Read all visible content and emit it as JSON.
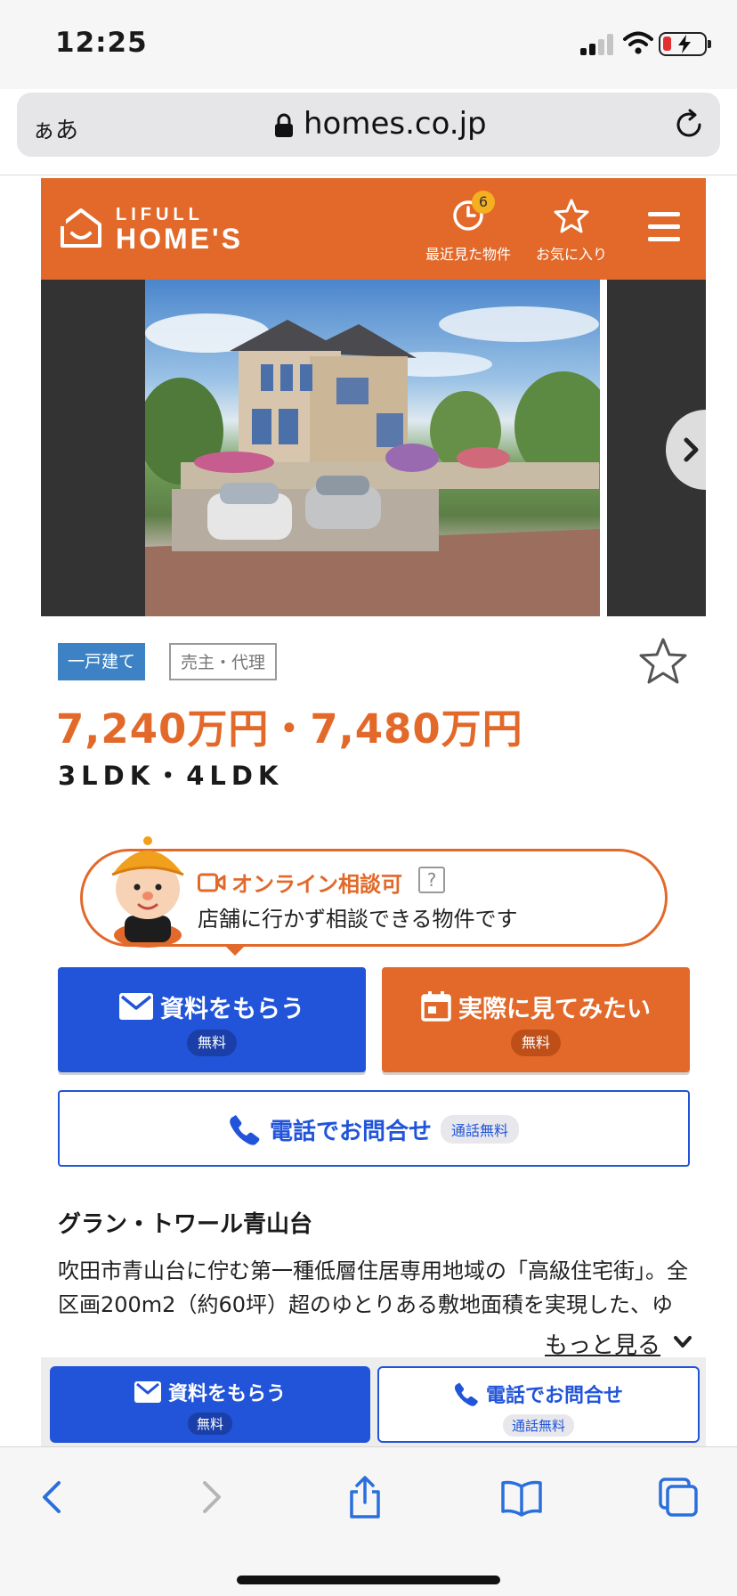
{
  "status_bar": {
    "time": "12:25"
  },
  "browser": {
    "text_size_label": "ぁあ",
    "url": "homes.co.jp"
  },
  "site_header": {
    "logo_top": "LIFULL",
    "logo_main": "HOME'S",
    "recent_label": "最近見た物件",
    "recent_count": "6",
    "favorites_label": "お気に入り"
  },
  "property": {
    "type_tag": "一戸建て",
    "deal_tag": "売主・代理",
    "price": "7,240万円・7,480万円",
    "layout": "3LDK・4LDK",
    "name": "グラン・トワール青山台",
    "description": "吹田市青山台に佇む第一種低層住居専用地域の「高級住宅街」。全区画200m2（約60坪）超のゆとりある敷地面積を実現した、ゆとりある住まい。",
    "more_label": "もっと見る"
  },
  "online": {
    "title": "オンライン相談可",
    "help": "?",
    "description": "店舗に行かず相談できる物件です"
  },
  "cta": {
    "request_docs": "資料をもらう",
    "request_docs_free": "無料",
    "visit": "実際に見てみたい",
    "visit_free": "無料",
    "phone": "電話でお問合せ",
    "phone_free": "通話無料"
  },
  "sticky_bar": {
    "request_docs": "資料をもらう",
    "request_docs_free": "無料",
    "phone": "電話でお問合せ",
    "phone_free": "通話無料"
  },
  "colors": {
    "brand_orange": "#e2692a",
    "cta_blue": "#2154d8",
    "tag_blue": "#3d82c4"
  },
  "icons": {
    "logo": "house-logo-icon",
    "recent": "clock-icon",
    "favorites": "star-icon",
    "menu": "hamburger-menu-icon",
    "mail": "mail-icon",
    "calendar": "calendar-icon",
    "phone": "phone-icon",
    "video": "video-camera-icon"
  }
}
